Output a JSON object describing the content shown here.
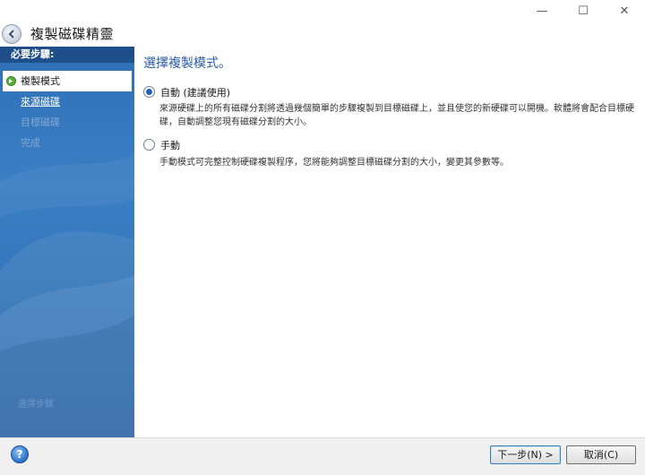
{
  "window": {
    "title": "複製磁碟精靈",
    "controls": {
      "minimize": "—",
      "maximize": "☐",
      "close": "✕"
    }
  },
  "sidebar": {
    "header": "必要步驟:",
    "steps": [
      {
        "label": "複製模式",
        "state": "active"
      },
      {
        "label": "來源磁碟",
        "state": "link"
      },
      {
        "label": "目標磁碟",
        "state": "disabled"
      },
      {
        "label": "完成",
        "state": "disabled"
      }
    ],
    "faint_label": "選擇步驟"
  },
  "main": {
    "title": "選擇複製模式。",
    "options": [
      {
        "label": "自動 (建議使用)",
        "checked": true,
        "description": "來源硬碟上的所有磁碟分割將透過幾個簡單的步驟複製到目標磁碟上，並且使您的新硬碟可以開機。軟體將會配合目標硬碟，自動調整您現有磁碟分割的大小。"
      },
      {
        "label": "手動",
        "checked": false,
        "description": "手動模式可完整控制硬碟複製程序，您將能夠調整目標磁碟分割的大小，變更其參數等。"
      }
    ]
  },
  "footer": {
    "help_icon": "question-icon",
    "next_label": "下一步(N) >",
    "cancel_label": "取消(C)"
  },
  "colors": {
    "sidebar": "#3a7fc4",
    "sidebar_header": "#1e4f8a",
    "title_accent": "#2a5ba8"
  }
}
